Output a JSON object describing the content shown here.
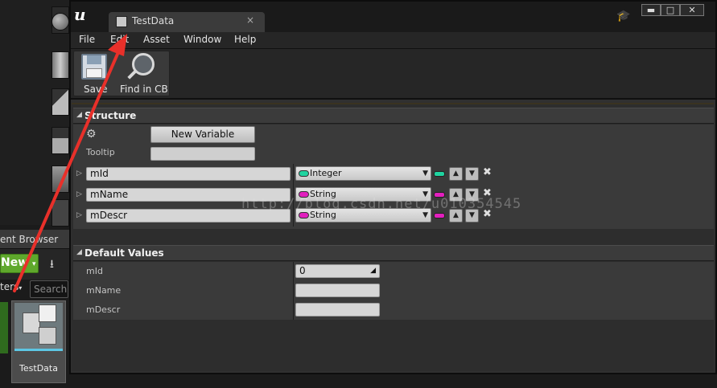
{
  "window": {
    "tab_title": "TestData",
    "tab_close": "×",
    "controls": {
      "minimize": "▬",
      "maximize": "□",
      "close": "✕"
    }
  },
  "menu": [
    "File",
    "Edit",
    "Asset",
    "Window",
    "Help"
  ],
  "toolbar": {
    "save_label": "Save",
    "find_label": "Find in CB"
  },
  "structure": {
    "header": "Structure",
    "new_variable_label": "New Variable",
    "tooltip_label": "Tooltip",
    "tooltip_value": "",
    "variables": [
      {
        "name": "mId",
        "type": "Integer",
        "type_color": "#1fd3a0",
        "pin_color": "#1fd3a0"
      },
      {
        "name": "mName",
        "type": "String",
        "type_color": "#e21fbe",
        "pin_color": "#e21fbe"
      },
      {
        "name": "mDescr",
        "type": "String",
        "type_color": "#e21fbe",
        "pin_color": "#e21fbe"
      }
    ]
  },
  "default_values": {
    "header": "Default Values",
    "rows": [
      {
        "label": "mId",
        "value": "0"
      },
      {
        "label": "mName",
        "value": ""
      },
      {
        "label": "mDescr",
        "value": ""
      }
    ]
  },
  "content_browser": {
    "tab_label": "ent Browser",
    "new_button": "New",
    "filters_label": "ters",
    "search_placeholder": "Search",
    "asset_name": "TestData"
  },
  "watermark": "http://blog.csdn.net/u010354545",
  "colors": {
    "accent_green": "#5fa82c",
    "annotation_red": "#e8302a",
    "selection_blue": "#5dc7e4"
  }
}
